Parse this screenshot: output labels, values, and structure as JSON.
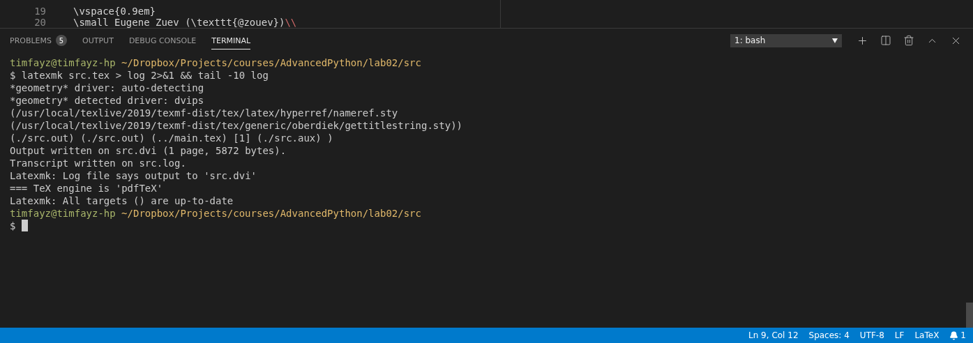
{
  "editor": {
    "lines": [
      {
        "number": "19",
        "tokens": [
          {
            "kind": "plain",
            "text": "\\vspace{0.9em}"
          }
        ]
      },
      {
        "number": "20",
        "tokens": [
          {
            "kind": "plain",
            "text": "\\small Eugene Zuev (\\texttt{@zouev})"
          },
          {
            "kind": "escape",
            "text": "\\\\"
          }
        ]
      }
    ]
  },
  "panel": {
    "tabs": [
      {
        "label": "PROBLEMS",
        "badge": "5",
        "selected": false
      },
      {
        "label": "OUTPUT",
        "selected": false
      },
      {
        "label": "DEBUG CONSOLE",
        "selected": false
      },
      {
        "label": "TERMINAL",
        "selected": true
      }
    ],
    "terminal_select": "1: bash"
  },
  "terminal": {
    "lines": [
      {
        "kind": "prompt",
        "user": "timfayz@timfayz-hp",
        "path": "~/Dropbox/Projects/courses/AdvancedPython/lab02/src"
      },
      {
        "kind": "text",
        "text": "$ latexmk src.tex > log 2>&1 && tail -10 log"
      },
      {
        "kind": "text",
        "text": "*geometry* driver: auto-detecting"
      },
      {
        "kind": "text",
        "text": "*geometry* detected driver: dvips"
      },
      {
        "kind": "text",
        "text": "(/usr/local/texlive/2019/texmf-dist/tex/latex/hyperref/nameref.sty"
      },
      {
        "kind": "text",
        "text": "(/usr/local/texlive/2019/texmf-dist/tex/generic/oberdiek/gettitlestring.sty))"
      },
      {
        "kind": "text",
        "text": "(./src.out) (./src.out) (../main.tex) [1] (./src.aux) )"
      },
      {
        "kind": "text",
        "text": "Output written on src.dvi (1 page, 5872 bytes)."
      },
      {
        "kind": "text",
        "text": "Transcript written on src.log."
      },
      {
        "kind": "text",
        "text": "Latexmk: Log file says output to 'src.dvi'"
      },
      {
        "kind": "text",
        "text": "=== TeX engine is 'pdfTeX'"
      },
      {
        "kind": "text",
        "text": "Latexmk: All targets () are up-to-date"
      },
      {
        "kind": "prompt",
        "user": "timfayz@timfayz-hp",
        "path": "~/Dropbox/Projects/courses/AdvancedPython/lab02/src"
      },
      {
        "kind": "input",
        "text": "$"
      }
    ]
  },
  "status_bar": {
    "items": [
      "Ln 9, Col 12",
      "Spaces: 4",
      "UTF-8",
      "LF",
      "LaTeX"
    ],
    "notifications": "1"
  }
}
